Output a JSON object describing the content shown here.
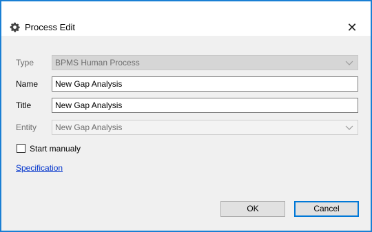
{
  "dialog": {
    "title": "Process Edit",
    "close_glyph": "✕",
    "title_icon": "gear-icon"
  },
  "form": {
    "type_label": "Type",
    "type_value": "BPMS Human Process",
    "name_label": "Name",
    "name_value": "New Gap Analysis",
    "title_label": "Title",
    "title_value": "New Gap Analysis",
    "entity_label": "Entity",
    "entity_value": "New Gap Analysis"
  },
  "options": {
    "start_manually_label": "Start manualy",
    "start_manually_checked": false
  },
  "links": {
    "specification": "Specification"
  },
  "buttons": {
    "ok": "OK",
    "cancel": "Cancel"
  },
  "colors": {
    "window_border": "#1a7fd4",
    "client_bg": "#f0f0f0",
    "link": "#0033cc",
    "default_button_border": "#0078d7"
  }
}
